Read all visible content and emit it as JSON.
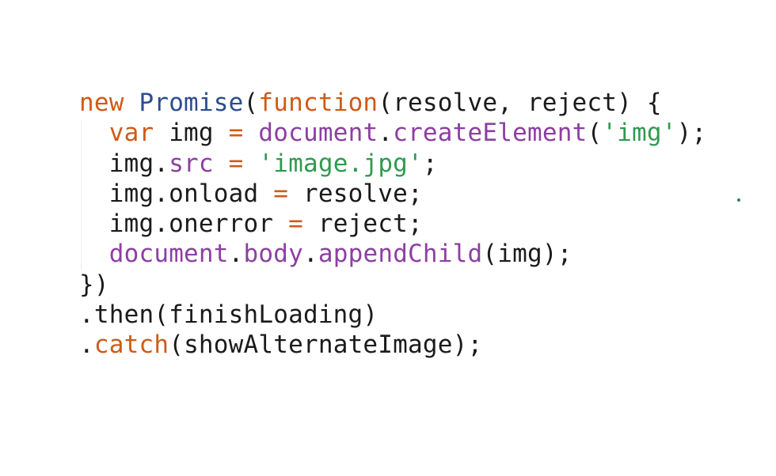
{
  "code": {
    "lines": [
      [
        {
          "t": "new",
          "c": "kw"
        },
        {
          "t": " ",
          "c": "plain"
        },
        {
          "t": "Promise",
          "c": "cls"
        },
        {
          "t": "(",
          "c": "plain"
        },
        {
          "t": "function",
          "c": "kw"
        },
        {
          "t": "(resolve, reject) {",
          "c": "plain"
        }
      ],
      [
        {
          "t": "  ",
          "c": "plain"
        },
        {
          "t": "var",
          "c": "kw"
        },
        {
          "t": " img ",
          "c": "plain"
        },
        {
          "t": "=",
          "c": "op"
        },
        {
          "t": " ",
          "c": "plain"
        },
        {
          "t": "document",
          "c": "prop"
        },
        {
          "t": ".",
          "c": "plain"
        },
        {
          "t": "createElement",
          "c": "prop"
        },
        {
          "t": "(",
          "c": "plain"
        },
        {
          "t": "'img'",
          "c": "str"
        },
        {
          "t": ");",
          "c": "plain"
        }
      ],
      [
        {
          "t": "  img.",
          "c": "plain"
        },
        {
          "t": "src",
          "c": "prop"
        },
        {
          "t": " ",
          "c": "plain"
        },
        {
          "t": "=",
          "c": "op"
        },
        {
          "t": " ",
          "c": "plain"
        },
        {
          "t": "'image.jpg'",
          "c": "str"
        },
        {
          "t": ";",
          "c": "plain"
        }
      ],
      [
        {
          "t": "  img.onload ",
          "c": "plain"
        },
        {
          "t": "=",
          "c": "op"
        },
        {
          "t": " resolve;",
          "c": "plain"
        }
      ],
      [
        {
          "t": "  img.onerror ",
          "c": "plain"
        },
        {
          "t": "=",
          "c": "op"
        },
        {
          "t": " reject;",
          "c": "plain"
        }
      ],
      [
        {
          "t": "  ",
          "c": "plain"
        },
        {
          "t": "document",
          "c": "prop"
        },
        {
          "t": ".",
          "c": "plain"
        },
        {
          "t": "body",
          "c": "prop"
        },
        {
          "t": ".",
          "c": "plain"
        },
        {
          "t": "appendChild",
          "c": "prop"
        },
        {
          "t": "(img);",
          "c": "plain"
        }
      ],
      [
        {
          "t": "})",
          "c": "plain"
        }
      ],
      [
        {
          "t": ".then(finishLoading)",
          "c": "plain"
        }
      ],
      [
        {
          "t": ".",
          "c": "plain"
        },
        {
          "t": "catch",
          "c": "kw"
        },
        {
          "t": "(showAlternateImage);",
          "c": "plain"
        }
      ]
    ]
  },
  "colors": {
    "keyword": "#cf5b16",
    "class": "#2b4c8f",
    "property": "#8d3fa2",
    "string": "#2f9a4f",
    "operator": "#cf5b16",
    "text": "#1b1b1b",
    "background": "#ffffff"
  }
}
